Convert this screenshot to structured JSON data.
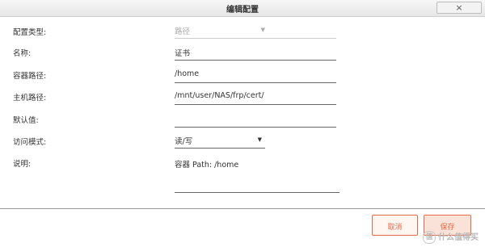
{
  "dialog": {
    "title": "编辑配置",
    "close_label": "×"
  },
  "form": {
    "config_type": {
      "label": "配置类型:",
      "value": "路径",
      "arrow": "▼"
    },
    "name": {
      "label": "名称:",
      "value": "证书"
    },
    "container_path": {
      "label": "容器路径:",
      "value": "/home"
    },
    "host_path": {
      "label": "主机路径:",
      "value": "/mnt/user/NAS/frp/cert/"
    },
    "default_value": {
      "label": "默认值:",
      "value": ""
    },
    "access_mode": {
      "label": "访问模式:",
      "value": "读/写",
      "arrow": "▼"
    },
    "description": {
      "label": "说明:",
      "value": "容器 Path: /home"
    }
  },
  "footer": {
    "cancel_label": "取消",
    "save_label": "保存"
  },
  "watermark": {
    "logo": "值",
    "text": "什么值得买"
  }
}
